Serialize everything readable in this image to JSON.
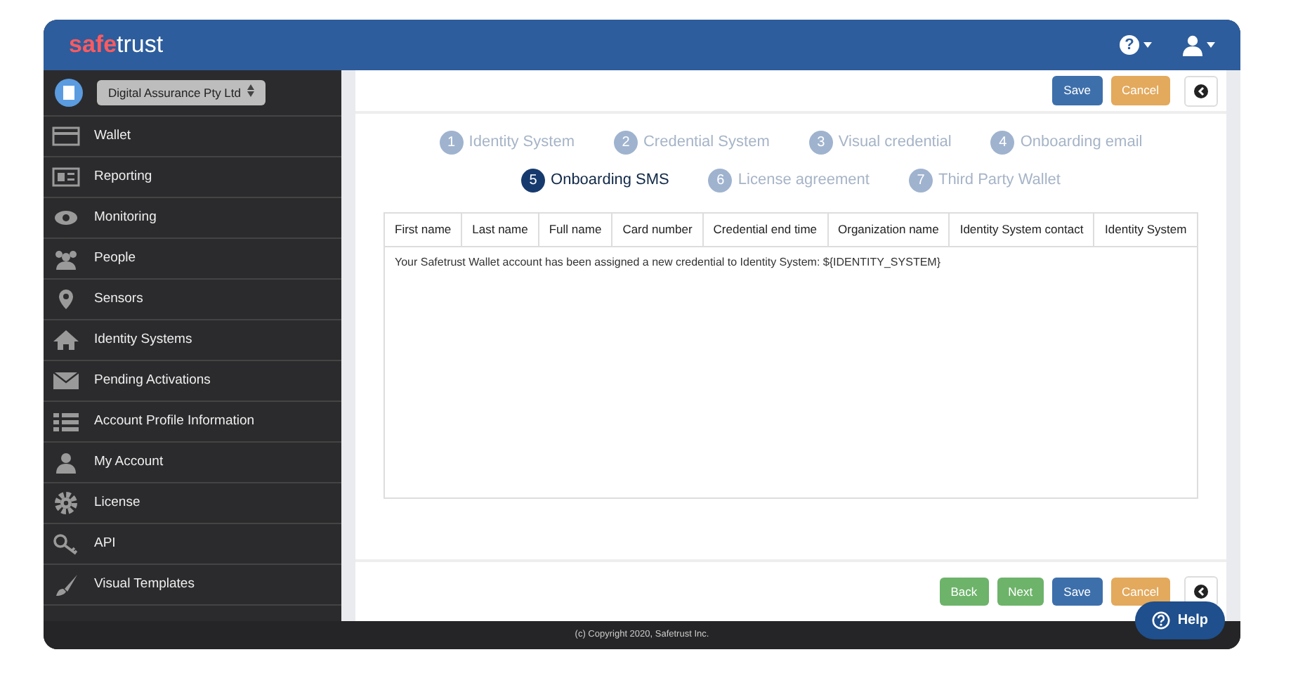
{
  "header": {
    "logo": {
      "part_1": "safe",
      "part_2": "trust"
    },
    "help_menu": "?"
  },
  "sidebar": {
    "organization": "Digital Assurance Pty Ltd",
    "items": [
      {
        "label": "Wallet"
      },
      {
        "label": "Reporting"
      },
      {
        "label": "Monitoring"
      },
      {
        "label": "People"
      },
      {
        "label": "Sensors"
      },
      {
        "label": "Identity Systems"
      },
      {
        "label": "Pending Activations"
      },
      {
        "label": "Account Profile Information"
      },
      {
        "label": "My Account"
      },
      {
        "label": "License"
      },
      {
        "label": "API"
      },
      {
        "label": "Visual Templates"
      }
    ]
  },
  "top_buttons": [
    {
      "label": "Save",
      "kind": "save"
    },
    {
      "label": "Cancel",
      "kind": "cancel"
    },
    {
      "kind": "back-circle"
    }
  ],
  "steps": [
    {
      "number": "1",
      "label": "Identity System",
      "selected": false
    },
    {
      "number": "2",
      "label": "Credential System",
      "selected": false
    },
    {
      "number": "3",
      "label": "Visual credential",
      "selected": false
    },
    {
      "number": "4",
      "label": "Onboarding email",
      "selected": false
    },
    {
      "number": "5",
      "label": "Onboarding SMS",
      "selected": true
    },
    {
      "number": "6",
      "label": "License agreement",
      "selected": false
    },
    {
      "number": "7",
      "label": "Third Party Wallet",
      "selected": false
    }
  ],
  "placeholders": [
    "First name",
    "Last name",
    "Full name",
    "Card number",
    "Credential end time",
    "Organization name",
    "Identity System contact",
    "Identity System"
  ],
  "message": "Your Safetrust Wallet account has been assigned a new credential to Identity System: ${IDENTITY_SYSTEM}",
  "bottom_buttons": [
    {
      "label": "Back",
      "kind": "back"
    },
    {
      "label": "Next",
      "kind": "next"
    },
    {
      "label": "Save",
      "kind": "save"
    },
    {
      "label": "Cancel",
      "kind": "cancel"
    },
    {
      "kind": "back-circle"
    }
  ],
  "footer": "(c) Copyright 2020, Safetrust Inc.",
  "help_button": "Help"
}
